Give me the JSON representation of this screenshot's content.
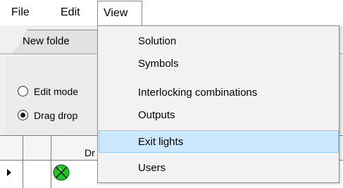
{
  "menubar": {
    "file": "File",
    "edit": "Edit",
    "view": "View"
  },
  "tabs": {
    "active_label": "New folde"
  },
  "radios": {
    "edit_mode": "Edit mode",
    "drag_drop": "Drag drop"
  },
  "grid": {
    "header_fragment": "Dr"
  },
  "dropdown": {
    "items": [
      {
        "label": "Solution"
      },
      {
        "label": "Symbols"
      },
      {
        "label": "Interlocking combinations"
      },
      {
        "label": "Outputs"
      },
      {
        "label": "Exit lights"
      },
      {
        "label": "Users"
      }
    ],
    "highlighted_index": 4
  },
  "icons": {
    "row_indicator": "row-selector-arrow-icon",
    "status_light": "green-crossed-circle-icon"
  },
  "colors": {
    "highlight_background": "#cce8ff",
    "highlight_border": "#99c9ef",
    "status_green": "#22c22a"
  }
}
